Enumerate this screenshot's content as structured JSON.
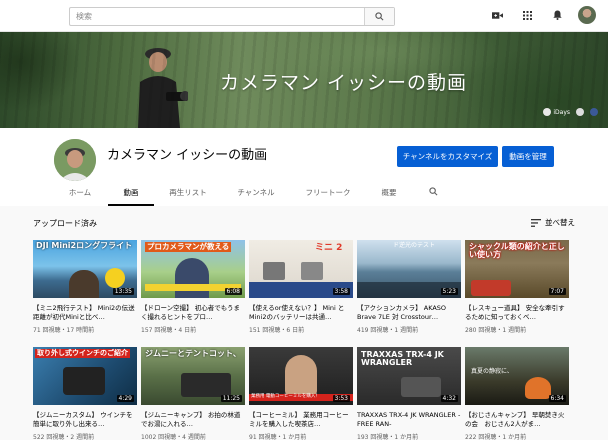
{
  "topbar": {
    "search_placeholder": "検索",
    "icons": [
      "video-camera-icon",
      "apps-grid-icon",
      "bell-icon",
      "avatar"
    ]
  },
  "banner": {
    "title": "カメラマン イッシーの動画",
    "link_label": "iDays"
  },
  "channel": {
    "name": "カメラマン イッシーの動画",
    "customize_label": "チャンネルをカスタマイズ",
    "manage_label": "動画を管理"
  },
  "tabs": [
    "ホーム",
    "動画",
    "再生リスト",
    "チャンネル",
    "フリートーク",
    "概要"
  ],
  "active_tab": "動画",
  "section": {
    "title": "アップロード済み",
    "sort_label": "並べ替え"
  },
  "videos": [
    {
      "title": "【ミニ2飛行テスト】 Mini2の伝送距離が初代Miniと比べ…",
      "meta": "71 回視聴・17 時間前",
      "duration": "13:35",
      "thumb_text": "DJI Mini2ロングフライト"
    },
    {
      "title": "【ドローン空撮】 初心者でもうまく撮れるヒントをプロ…",
      "meta": "157 回視聴・4 日前",
      "duration": "6:08",
      "thumb_text": "プロカメラマンが教える"
    },
    {
      "title": "【使えるor使えない？】 Mini とMini2のバッテリーは共通…",
      "meta": "151 回視聴・6 日前",
      "duration": "3:58",
      "thumb_text": "ミニ 2"
    },
    {
      "title": "【アクションカメラ】 AKASO Brave 7LE 対 Crosstour…",
      "meta": "419 回視聴・1 週間前",
      "duration": "5:23",
      "thumb_text": "ド逆光のテスト"
    },
    {
      "title": "【レスキュー道具】 安全な牽引するために知っておくべ…",
      "meta": "280 回視聴・1 週間前",
      "duration": "7:07",
      "thumb_text": "シャックル類の紹介と正しい使い方"
    },
    {
      "title": "【ジムニーカスタム】 ウインチを簡単に取り外し出来る…",
      "meta": "522 回視聴・2 週間前",
      "duration": "4:29",
      "thumb_text": "取り外し式ウインチのご紹介"
    },
    {
      "title": "【ジムニーキャンプ】 お拍の林道でお湯に入れる…",
      "meta": "1002 回視聴・4 週間前",
      "duration": "11:25",
      "thumb_text": "ジムニーとテントコット、"
    },
    {
      "title": "【コーヒーミル】 業務用コーヒーミルを購入した喫茶店…",
      "meta": "91 回視聴・1 か月前",
      "duration": "3:53",
      "thumb_text": "業務用 電動コーヒーミルを購入！"
    },
    {
      "title": "TRAXXAS TRX-4 JK WRANGLER -FREE RAN-",
      "meta": "193 回視聴・1 か月前",
      "duration": "4:32",
      "thumb_text": "TRAXXAS TRX-4 JK WRANGLER"
    },
    {
      "title": "【おじさんキャンプ】 早朝焚き火の会　おじさん2人がま…",
      "meta": "222 回視聴・1 か月前",
      "duration": "6:34",
      "thumb_text": "真夏の静寂に、"
    }
  ],
  "colors": {
    "accent": "#065fd4",
    "text": "#030303",
    "meta": "#606060"
  }
}
